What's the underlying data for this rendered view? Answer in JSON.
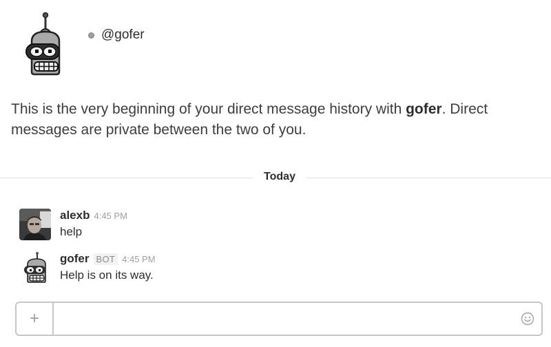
{
  "intro": {
    "handle": "@gofer",
    "text_before": "This is the very beginning of your direct message history with ",
    "text_bold": "gofer",
    "text_after": ". Direct messages are private between the two of you."
  },
  "divider": {
    "label": "Today"
  },
  "messages": [
    {
      "sender": "alexb",
      "time": "4:45 PM",
      "text": "help",
      "avatar": "user-photo-avatar"
    },
    {
      "sender": "gofer",
      "badge": "BOT",
      "time": "4:45 PM",
      "text": "Help is on its way.",
      "avatar": "robot-avatar"
    }
  ],
  "composer": {
    "plus_icon": "+",
    "value": "",
    "placeholder": "",
    "emoji_icon": "smiley-icon"
  },
  "colors": {
    "presence_away": "#9e9ea6",
    "text_primary": "#2c2d30",
    "text_muted": "#9e9ea6",
    "border": "#c6c6c9"
  }
}
